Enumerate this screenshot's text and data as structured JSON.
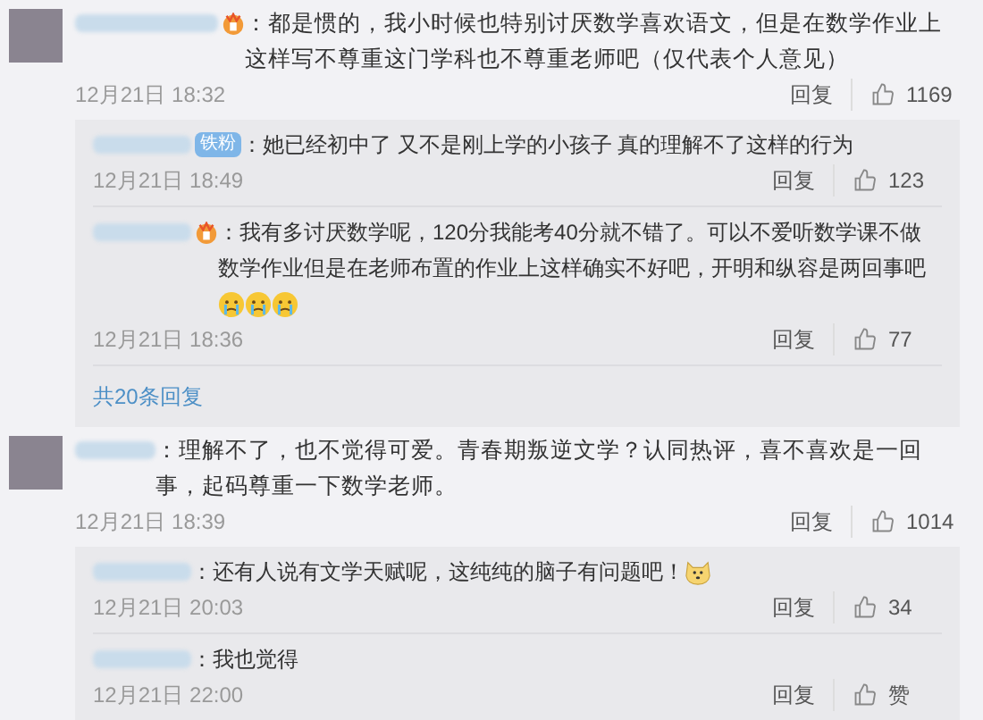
{
  "comments": [
    {
      "badge": {
        "kind": "vip"
      },
      "text": "：都是惯的，我小时候也特别讨厌数学喜欢语文，但是在数学作业上这样写不尊重这门学科也不尊重老师吧（仅代表个人意见）",
      "time": "12月21日 18:32",
      "reply": "回复",
      "likes": "1169",
      "replies": [
        {
          "badge": {
            "kind": "label",
            "text": "铁粉"
          },
          "text": "：她已经初中了 又不是刚上学的小孩子 真的理解不了这样的行为",
          "time": "12月21日 18:49",
          "reply": "回复",
          "likes": "123"
        },
        {
          "badge": {
            "kind": "vip"
          },
          "text": "：我有多讨厌数学呢，120分我能考40分就不错了。可以不爱听数学课不做数学作业但是在老师布置的作业上这样确实不好吧，开明和纵容是两回事吧",
          "time": "12月21日 18:36",
          "reply": "回复",
          "likes": "77",
          "emojis": [
            {
              "kind": "crying"
            },
            {
              "kind": "crying"
            },
            {
              "kind": "crying"
            }
          ]
        }
      ],
      "more": "共20条回复"
    },
    {
      "text": "：理解不了，也不觉得可爱。青春期叛逆文学？认同热评，喜不喜欢是一回事，起码尊重一下数学老师。",
      "time": "12月21日 18:39",
      "reply": "回复",
      "likes": "1014",
      "replies": [
        {
          "text": "：还有人说有文学天赋呢，这纯纯的脑子有问题吧！",
          "time": "12月21日 20:03",
          "reply": "回复",
          "likes": "34",
          "emojis": [
            {
              "kind": "dog"
            }
          ]
        },
        {
          "text": "：我也觉得",
          "time": "12月21日 22:00",
          "reply": "回复",
          "likes": "赞"
        }
      ]
    }
  ]
}
